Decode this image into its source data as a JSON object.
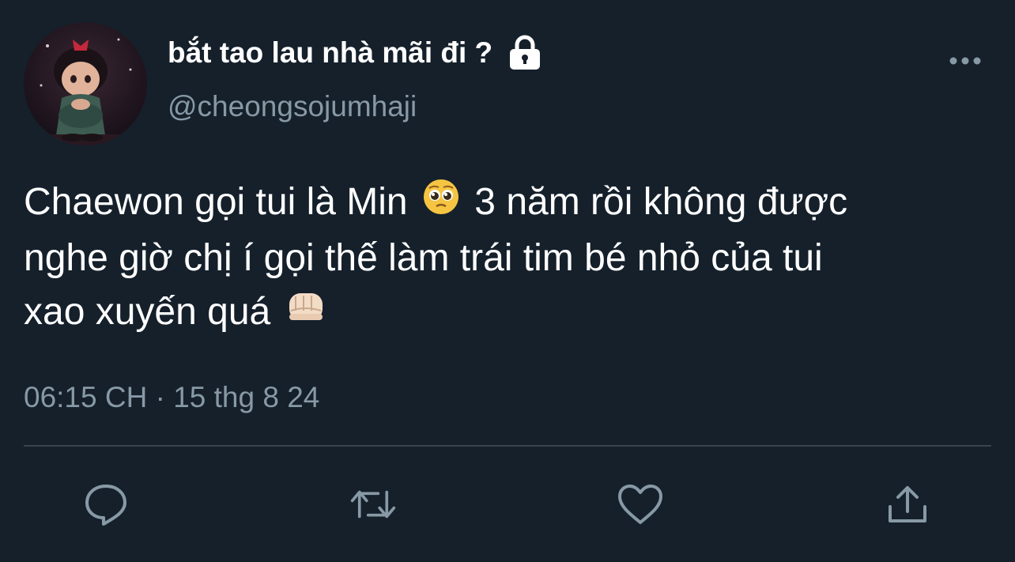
{
  "user": {
    "display_name": "bắt tao lau nhà mãi đi ?",
    "handle": "@cheongsojumhaji",
    "protected": true
  },
  "tweet": {
    "line1_a": "Chaewon gọi tui là Min",
    "line1_b": "3 năm rồi không được",
    "line2": "nghe giờ chị í gọi thế làm trái tim bé nhỏ của tui",
    "line3": "xao xuyến quá",
    "emoji_1": "pleading-face",
    "emoji_2": "oncoming-fist-light-skin-tone",
    "timestamp": "06:15 CH · 15 thg 8 24"
  },
  "actions": {
    "reply": "reply-icon",
    "retweet": "retweet-icon",
    "like": "heart-icon",
    "share": "share-icon"
  },
  "colors": {
    "background": "#15202b",
    "text": "#ffffff",
    "secondary_text": "#8899a6",
    "divider": "#38444d",
    "icon": "#8899a6"
  }
}
